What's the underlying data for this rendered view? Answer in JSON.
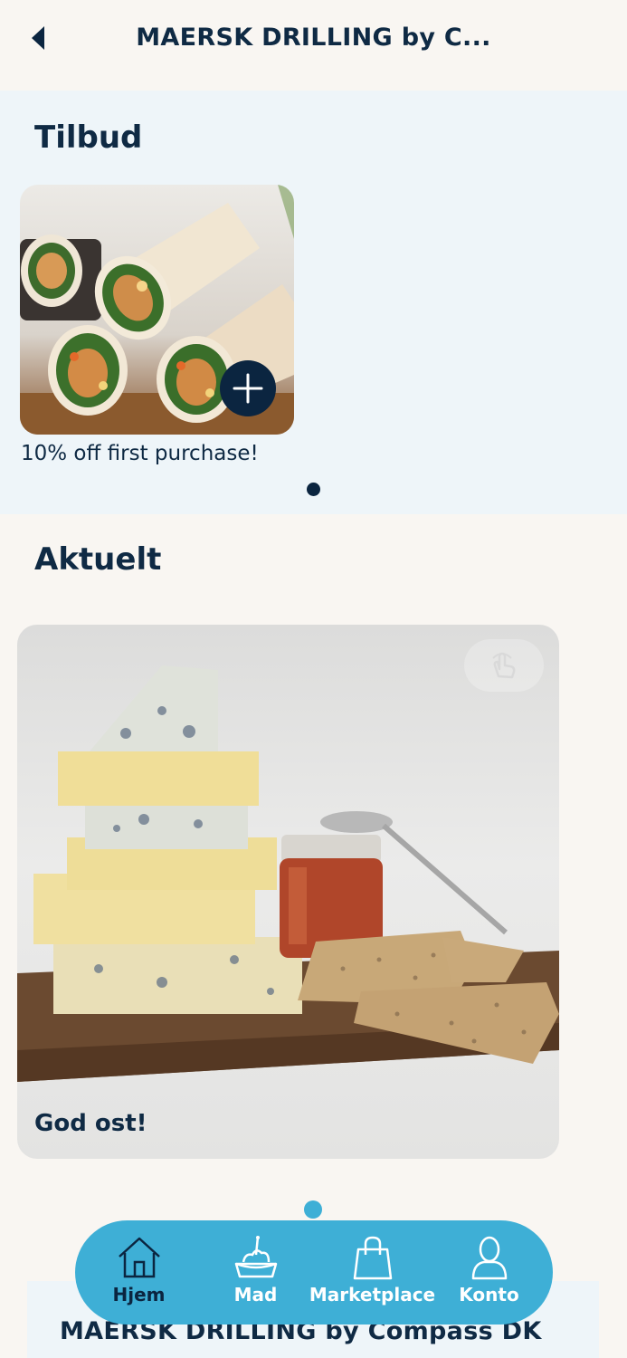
{
  "header": {
    "back_icon": "chevron-left-icon",
    "title": "MAERSK DRILLING by C..."
  },
  "offers_section": {
    "title": "Tilbud",
    "card": {
      "image": "chicken wraps",
      "add_icon": "plus-icon",
      "caption": "10% off first purchase!"
    }
  },
  "news_section": {
    "title": "Aktuelt",
    "card": {
      "image": "cheese board with crackers and jam",
      "hint_icon": "tap-hand-icon",
      "caption": "God ost!"
    }
  },
  "footer": {
    "title": "MAERSK DRILLING by Compass DK"
  },
  "bottom_nav": {
    "items": [
      {
        "label": "Hjem",
        "icon": "home-icon",
        "active": true
      },
      {
        "label": "Mad",
        "icon": "food-icon",
        "active": false
      },
      {
        "label": "Marketplace",
        "icon": "shopping-bag-icon",
        "active": false
      },
      {
        "label": "Konto",
        "icon": "person-icon",
        "active": false
      }
    ]
  },
  "colors": {
    "navy": "#0f2a44",
    "nav_bg": "#3eafd6",
    "offers_bg": "#eef5f9",
    "page_bg": "#f9f6f2"
  }
}
